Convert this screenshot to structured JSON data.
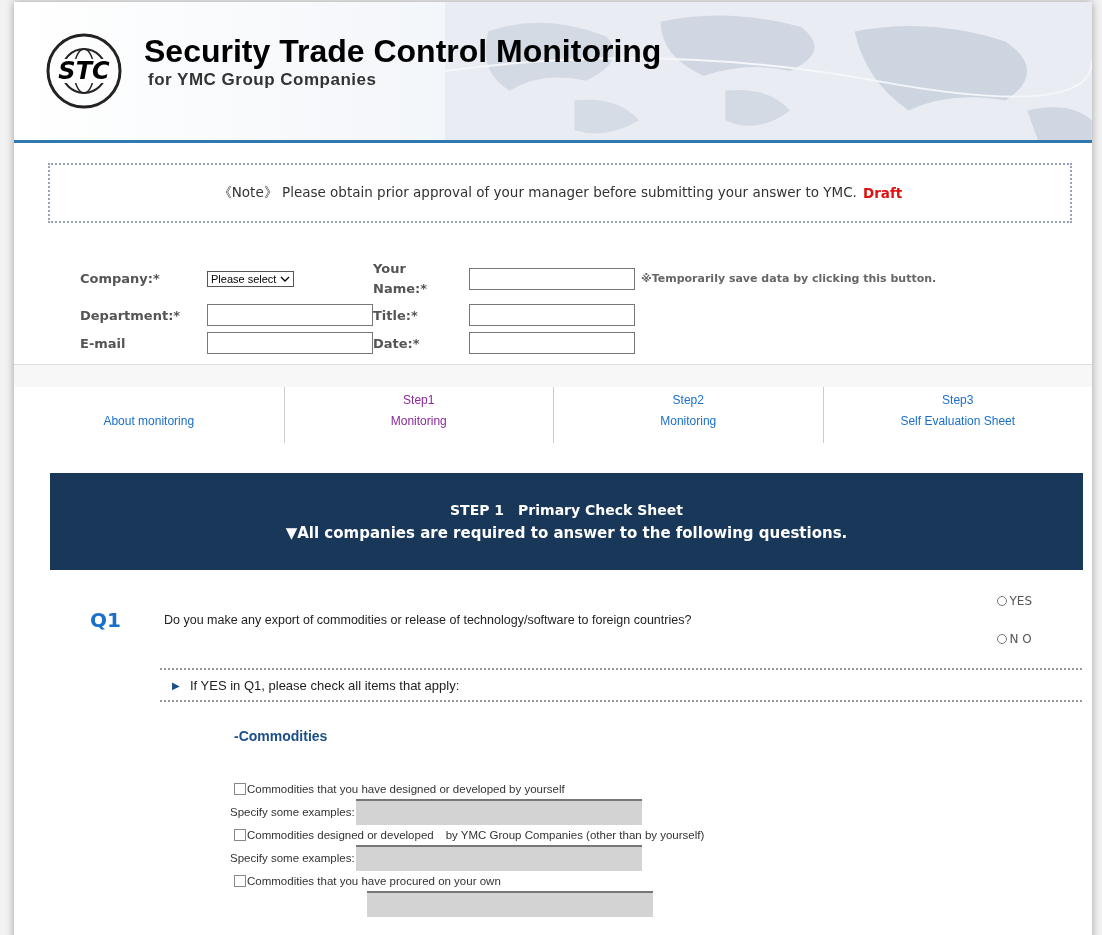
{
  "header": {
    "logo": "STC",
    "title": "Security Trade Control Monitoring",
    "subtitle": "for YMC Group Companies"
  },
  "note": {
    "text": "《Note》 Please obtain prior approval of your manager before submitting your answer to YMC.",
    "status": "Draft"
  },
  "form": {
    "company_label": "Company:*",
    "company_select": "Please select",
    "name_label": "Your Name:*",
    "save_hint": "※Temporarily save data by clicking this button.",
    "department_label": "Department:*",
    "title_label": "Title:*",
    "email_label": "E-mail",
    "date_label": "Date:*"
  },
  "steps": [
    {
      "line2": "About monitoring",
      "selected": false
    },
    {
      "line1": "Step1",
      "line2": "Monitoring",
      "selected": true
    },
    {
      "line1": "Step2",
      "line2": "Monitoring",
      "selected": false
    },
    {
      "line1": "Step3",
      "line2": "Self Evaluation Sheet",
      "selected": false
    }
  ],
  "banner": {
    "title": "STEP 1　Primary Check Sheet",
    "subtitle": "▼All companies are required to answer to the following questions."
  },
  "question": {
    "number": "Q1",
    "text": "Do you make any export of commodities or release of technology/software to foreign countries?",
    "options": [
      {
        "label": "YES",
        "selected": false
      },
      {
        "label": "N O",
        "selected": false
      }
    ]
  },
  "followup": {
    "marker": "▶",
    "text": "If YES in Q1, please check all items that apply:"
  },
  "section": "-Commodities",
  "items": [
    {
      "label": "Commodities that you have designed or developed by yourself",
      "checked": false,
      "field_label": "Specify some examples:"
    },
    {
      "label": "Commodities designed or developed　by YMC Group Companies (other than by yourself)",
      "checked": false,
      "field_label": "Specify some examples:"
    },
    {
      "label": "Commodities that you have procured on your own",
      "checked": false
    }
  ]
}
